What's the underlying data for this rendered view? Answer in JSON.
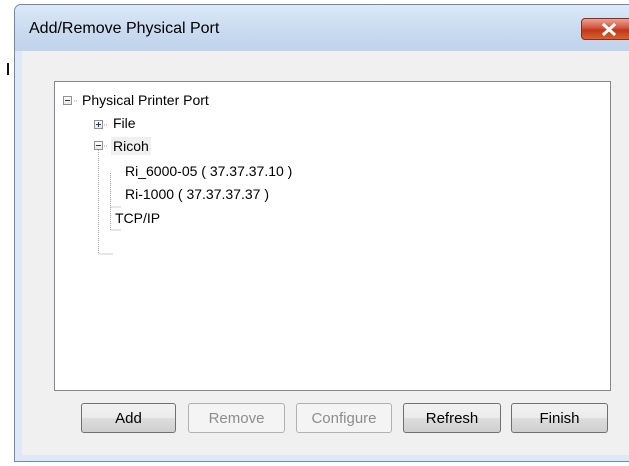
{
  "window": {
    "title": "Add/Remove Physical Port",
    "close_icon": "close-icon"
  },
  "tree": {
    "root": {
      "label": "Physical Printer Port",
      "expanded": true
    },
    "items": [
      {
        "label": "File",
        "expanded": false,
        "level": 1
      },
      {
        "label": "Ricoh",
        "expanded": true,
        "level": 1,
        "selected": true
      },
      {
        "label": "Ri_6000-05 ( 37.37.37.10 )",
        "level": 2
      },
      {
        "label": "Ri-1000 ( 37.37.37.37 )",
        "level": 2
      },
      {
        "label": "TCP/IP",
        "level": 1
      }
    ]
  },
  "buttons": {
    "add": {
      "label": "Add",
      "enabled": true
    },
    "remove": {
      "label": "Remove",
      "enabled": false
    },
    "configure": {
      "label": "Configure",
      "enabled": false
    },
    "refresh": {
      "label": "Refresh",
      "enabled": true
    },
    "finish": {
      "label": "Finish",
      "enabled": true
    }
  },
  "colors": {
    "titlebar": "#c9dbef",
    "close_button": "#c23618",
    "client_background": "#f0f0f0",
    "tree_background": "#ffffff"
  }
}
